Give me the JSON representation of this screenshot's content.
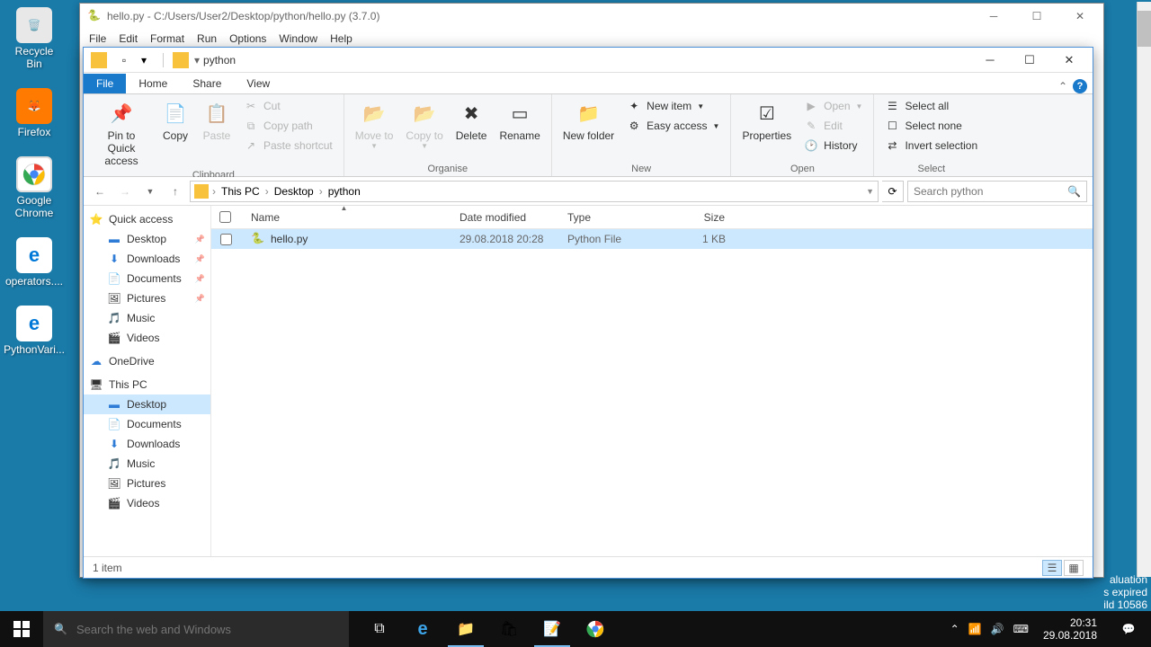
{
  "desktop": {
    "icons": [
      {
        "name": "recycle-bin",
        "label": "Recycle Bin"
      },
      {
        "name": "firefox",
        "label": "Firefox"
      },
      {
        "name": "chrome",
        "label": "Google Chrome"
      },
      {
        "name": "operators",
        "label": "operators...."
      },
      {
        "name": "python-vari",
        "label": "PythonVari..."
      }
    ]
  },
  "idle": {
    "title": "hello.py - C:/Users/User2/Desktop/python/hello.py (3.7.0)",
    "menu": [
      "File",
      "Edit",
      "Format",
      "Run",
      "Options",
      "Window",
      "Help"
    ]
  },
  "explorer": {
    "title": "python",
    "tabs": {
      "file": "File",
      "home": "Home",
      "share": "Share",
      "view": "View"
    },
    "ribbon": {
      "clipboard": {
        "label": "Clipboard",
        "pin": "Pin to Quick access",
        "copy": "Copy",
        "paste": "Paste",
        "cut": "Cut",
        "copy_path": "Copy path",
        "paste_shortcut": "Paste shortcut"
      },
      "organise": {
        "label": "Organise",
        "move_to": "Move to",
        "copy_to": "Copy to",
        "delete": "Delete",
        "rename": "Rename"
      },
      "new": {
        "label": "New",
        "new_folder": "New folder",
        "new_item": "New item",
        "easy_access": "Easy access"
      },
      "open": {
        "label": "Open",
        "properties": "Properties",
        "open": "Open",
        "edit": "Edit",
        "history": "History"
      },
      "select": {
        "label": "Select",
        "select_all": "Select all",
        "select_none": "Select none",
        "invert": "Invert selection"
      }
    },
    "breadcrumb": [
      "This PC",
      "Desktop",
      "python"
    ],
    "search_placeholder": "Search python",
    "nav_pane": {
      "quick_access": "Quick access",
      "quick_items": [
        "Desktop",
        "Downloads",
        "Documents",
        "Pictures",
        "Music",
        "Videos"
      ],
      "onedrive": "OneDrive",
      "this_pc": "This PC",
      "pc_items": [
        "Desktop",
        "Documents",
        "Downloads",
        "Music",
        "Pictures",
        "Videos"
      ]
    },
    "columns": {
      "name": "Name",
      "date": "Date modified",
      "type": "Type",
      "size": "Size"
    },
    "files": [
      {
        "name": "hello.py",
        "date": "29.08.2018 20:28",
        "type": "Python File",
        "size": "1 KB"
      }
    ],
    "status": "1 item"
  },
  "watermark": {
    "l1": "aluation",
    "l2": "s expired",
    "l3": "ild 10586"
  },
  "taskbar": {
    "search_placeholder": "Search the web and Windows",
    "clock_time": "20:31",
    "clock_date": "29.08.2018"
  },
  "colors": {
    "accent": "#1979ca",
    "selection": "#cce8ff",
    "desktop_bg": "#1a7aa8"
  }
}
